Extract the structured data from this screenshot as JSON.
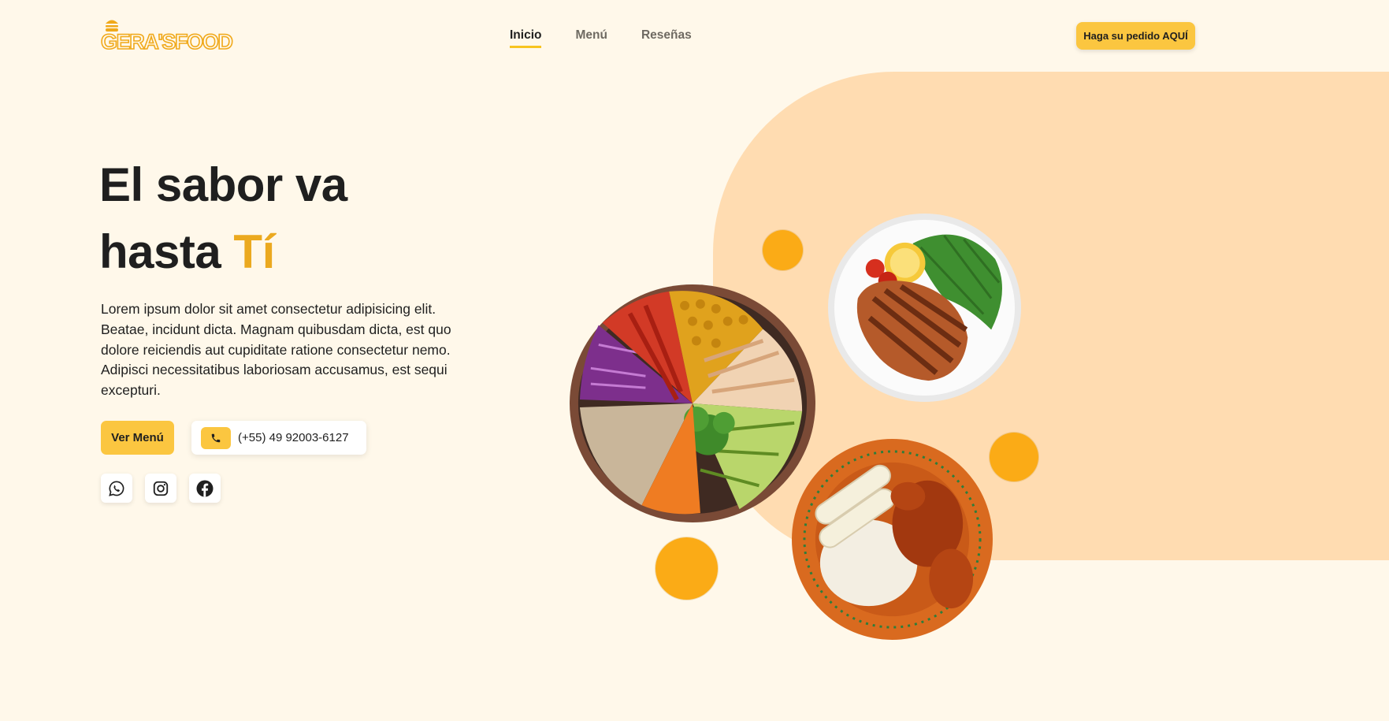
{
  "header": {
    "logo_text": "GERA'SFOOD",
    "nav": [
      {
        "label": "Inicio",
        "active": true
      },
      {
        "label": "Menú",
        "active": false
      },
      {
        "label": "Reseñas",
        "active": false
      }
    ],
    "order_button": "Haga su pedido AQUÍ"
  },
  "hero": {
    "title_line1": "El sabor va",
    "title_line2_plain": "hasta ",
    "title_line2_accent": "Tí",
    "description": "Lorem ipsum dolor sit amet consectetur adipisicing elit. Beatae, incidunt dicta. Magnam quibusdam dicta, est quo dolore reiciendis aut cupiditate ratione consectetur nemo. Adipisci necessitatibus laboriosam accusamus, est sequi excepturi.",
    "menu_button": "Ver Menú",
    "phone": "(+55) 49 92003-6127"
  },
  "socials": [
    {
      "icon": "whatsapp-icon"
    },
    {
      "icon": "instagram-icon"
    },
    {
      "icon": "facebook-icon"
    }
  ],
  "images": [
    {
      "icon": "bowl-salad-image"
    },
    {
      "icon": "grilled-chicken-plate-image"
    },
    {
      "icon": "mole-chicken-rice-plate-image"
    }
  ],
  "colors": {
    "background": "#fff8ea",
    "accent": "#fbc640",
    "accent_text": "#eba91f",
    "blob": "#ffdcb1",
    "dots": "#fbab16"
  }
}
